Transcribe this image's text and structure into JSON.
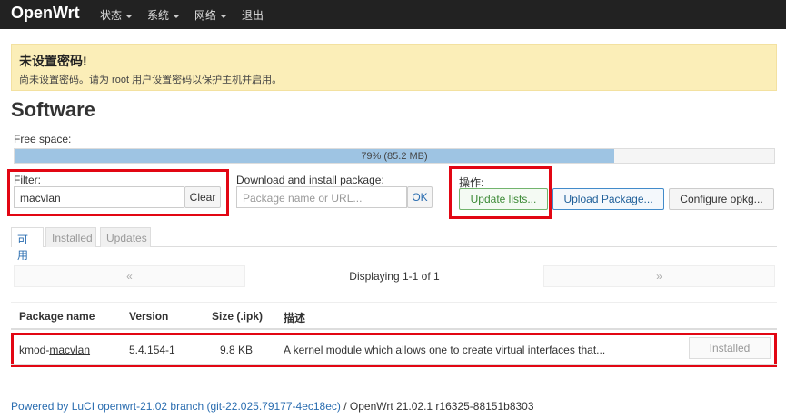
{
  "app": {
    "brand": "OpenWrt"
  },
  "nav": {
    "status": "状态",
    "system": "系统",
    "network": "网络",
    "logout": "退出"
  },
  "alert": {
    "title": "未设置密码!",
    "text": "尚未设置密码。请为 root 用户设置密码以保护主机并启用。"
  },
  "page": {
    "title": "Software"
  },
  "free_space": {
    "label": "Free space:",
    "percent": 79,
    "text": "79% (85.2 MB)"
  },
  "filter": {
    "label": "Filter:",
    "value": "macvlan",
    "clear_label": "Clear"
  },
  "download": {
    "label": "Download and install package:",
    "placeholder": "Package name or URL...",
    "ok_label": "OK"
  },
  "actions": {
    "label": "操作:",
    "update_lists": "Update lists...",
    "upload_package": "Upload Package...",
    "configure_opkg": "Configure opkg..."
  },
  "tabs": [
    {
      "label": "可用",
      "active": true
    },
    {
      "label": "Installed",
      "active": false
    },
    {
      "label": "Updates",
      "active": false
    }
  ],
  "pager": {
    "prev": "«",
    "next": "»",
    "text": "Displaying 1-1 of 1"
  },
  "table": {
    "headers": [
      "Package name",
      "Version",
      "Size (.ipk)",
      "描述"
    ],
    "rows": [
      {
        "name_prefix": "kmod-",
        "name_link": "macvlan",
        "version": "5.4.154-1",
        "size": "9.8 KB",
        "description": "A kernel module which allows one to create virtual interfaces that...",
        "action": "Installed"
      }
    ]
  },
  "footer": {
    "link_text": "Powered by LuCI openwrt-21.02 branch (git-22.025.79177-4ec18ec)",
    "version_text": " / OpenWrt 21.02.1 r16325-88151b8303"
  },
  "colors": {
    "highlight_box": "#e20613",
    "progress_fill": "#9ec4e3",
    "alert_bg": "#fbeeb8"
  }
}
